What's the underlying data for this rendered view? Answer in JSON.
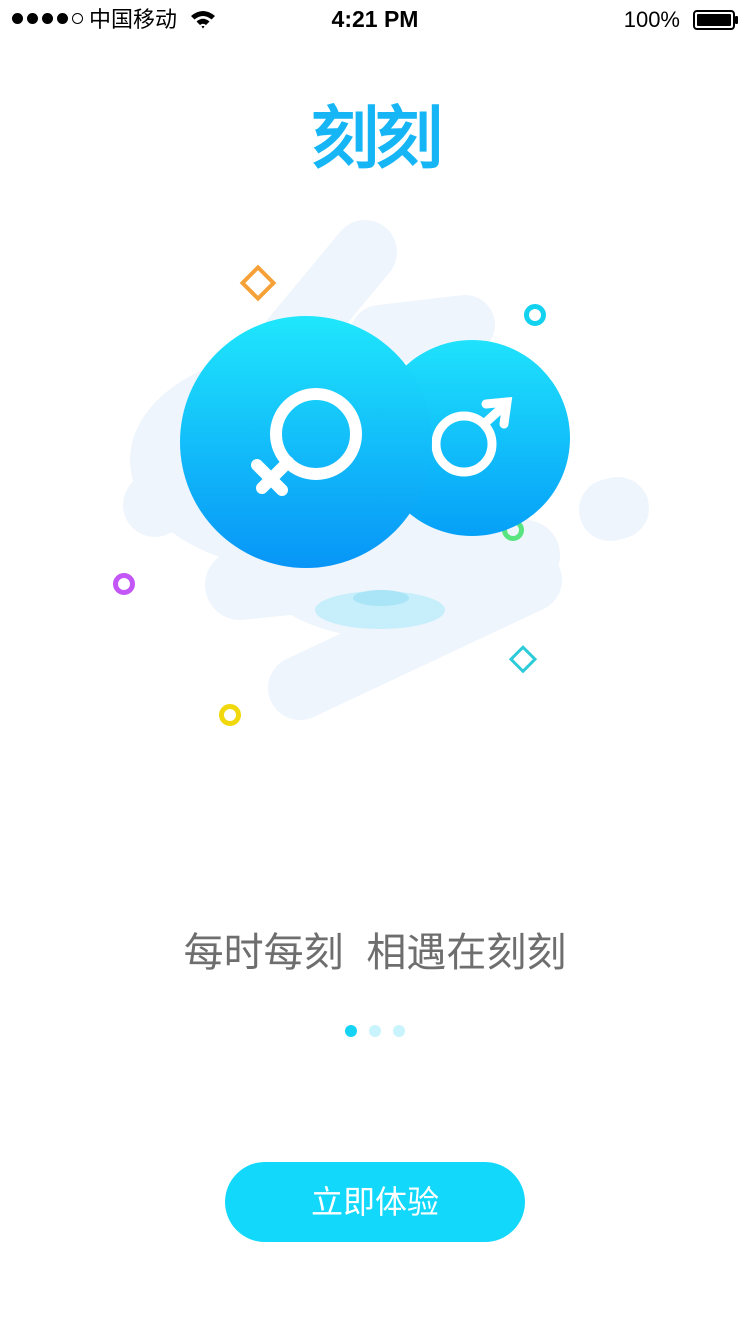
{
  "status_bar": {
    "carrier": "中国移动",
    "time": "4:21 PM",
    "battery_percent": "100%",
    "signal_bars_filled": 4,
    "signal_bars_total": 5,
    "battery_level": 1.0
  },
  "splash": {
    "app_name": "刻刻",
    "tagline": "每时每刻 相遇在刻刻",
    "page_count": 3,
    "active_page": 1,
    "cta_label": "立即体验"
  },
  "icons": {
    "female": "female-symbol-icon",
    "male": "male-symbol-icon",
    "wifi": "wifi-icon",
    "battery": "battery-icon"
  },
  "colors": {
    "brand": "#16b6f6",
    "accent": "#12d8fc",
    "tagline": "#6e6e6e",
    "pager_active": "#14d3f5",
    "pager_inactive": "#c9f3fd"
  }
}
